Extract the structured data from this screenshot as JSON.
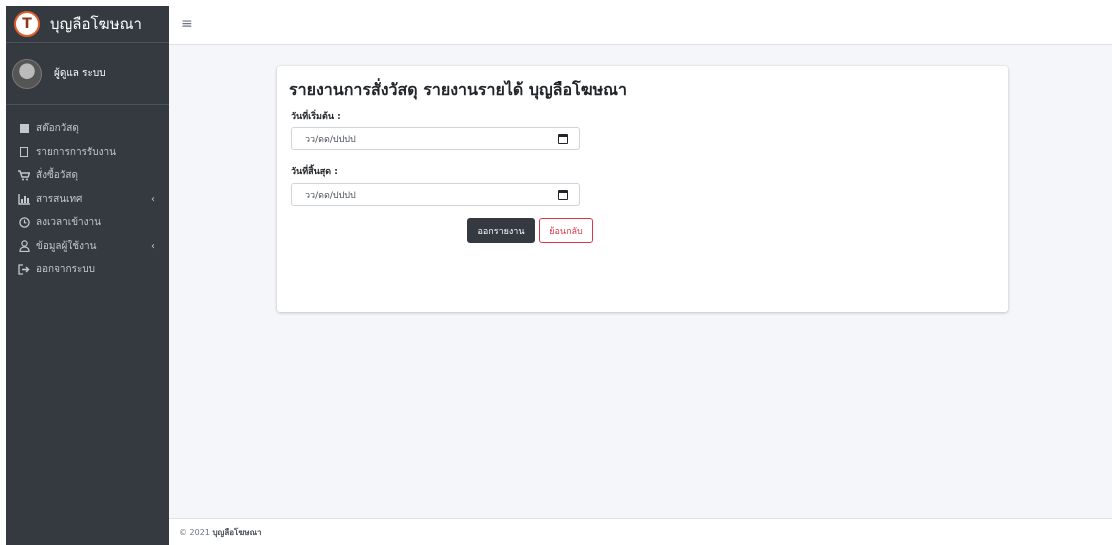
{
  "brand": {
    "title": "บุญลือโฆษณา",
    "logo_icon": "T"
  },
  "user": {
    "name": "ผู้ดูแล ระบบ"
  },
  "sidebar": {
    "items": [
      {
        "label": "สต๊อกวัสดุ",
        "icon": "box-icon"
      },
      {
        "label": "รายการการรับงาน",
        "icon": "document-icon"
      },
      {
        "label": "สั่งซื้อวัสดุ",
        "icon": "cart-icon"
      },
      {
        "label": "สารสนเทศ",
        "icon": "chart-icon",
        "chevron": "‹"
      },
      {
        "label": "ลงเวลาเข้างาน",
        "icon": "clock-icon"
      },
      {
        "label": "ข้อมูลผู้ใช้งาน",
        "icon": "user-icon",
        "chevron": "‹"
      },
      {
        "label": "ออกจากระบบ",
        "icon": "logout-icon"
      }
    ]
  },
  "topbar": {
    "menu_icon": "≡"
  },
  "main": {
    "title": "รายงานการสั่งวัสดุ รายงานรายได้ บุญลือโฆษณา",
    "start_label": "วันที่เริ่มต้น :",
    "start_placeholder": "วว/ดด/ปปปป",
    "end_label": "วันที่สิ้นสุด :",
    "end_placeholder": "วว/ดด/ปปปป",
    "report_button": "ออกรายงาน",
    "back_button": "ย้อนกลับ"
  },
  "footer": {
    "copyright": "© 2021",
    "name": "บุญลือโฆษณา"
  },
  "colors": {
    "sidebar_bg": "#343a40",
    "dark_button": "#343a40",
    "danger": "#dc3545",
    "page_bg": "#f4f6f9"
  }
}
